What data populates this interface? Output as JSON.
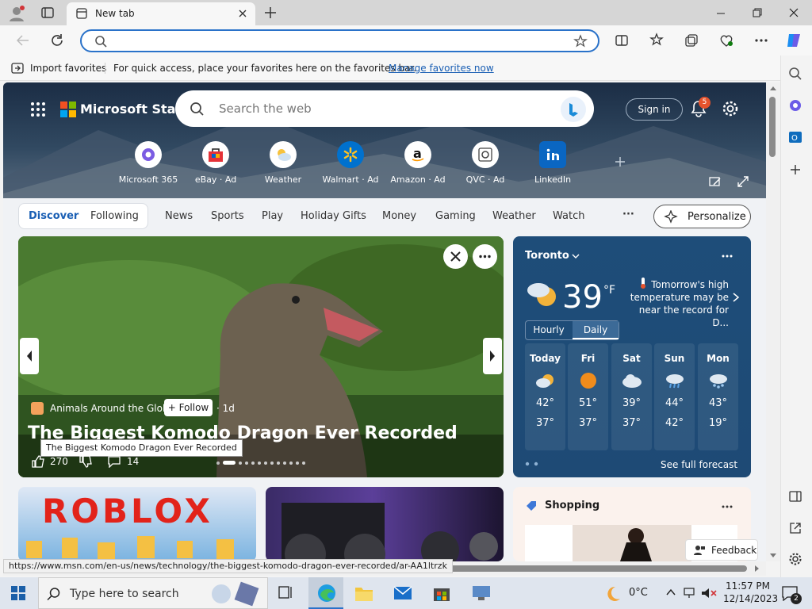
{
  "browser": {
    "tab_title": "New tab",
    "address_value": "",
    "favorites_bar": {
      "import_label": "Import favorites",
      "hint": "For quick access, place your favorites here on the favorites bar.",
      "manage_link": "Manage favorites now"
    },
    "status_url": "https://www.msn.com/en-us/news/technology/the-biggest-komodo-dragon-ever-recorded/ar-AA1ltrzk"
  },
  "msn": {
    "brand": "Microsoft Start",
    "search_placeholder": "Search the web",
    "sign_in": "Sign in",
    "notification_count": "5",
    "quick_links": [
      {
        "label": "Microsoft 365"
      },
      {
        "label": "eBay · Ad"
      },
      {
        "label": "Weather"
      },
      {
        "label": "Walmart · Ad"
      },
      {
        "label": "Amazon · Ad"
      },
      {
        "label": "QVC · Ad"
      },
      {
        "label": "LinkedIn"
      }
    ],
    "nav_tabs": [
      "Discover",
      "Following",
      "News",
      "Sports",
      "Play",
      "Holiday Gifts",
      "Money",
      "Gaming",
      "Weather",
      "Watch"
    ],
    "nav_more": "···",
    "personalize": "Personalize"
  },
  "hero": {
    "source": "Animals Around the Globe",
    "follow": "+ Follow",
    "age": "· 1d",
    "headline": "The Biggest Komodo Dragon Ever Recorded",
    "tooltip": "The Biggest Komodo Dragon Ever Recorded",
    "likes": "270",
    "comments": "14"
  },
  "weather": {
    "city": "Toronto",
    "temp": "39",
    "unit": "°F",
    "note": "Tomorrow's high temperature may be near the record for D...",
    "tab_hourly": "Hourly",
    "tab_daily": "Daily",
    "days": [
      {
        "day": "Today",
        "high": "42°",
        "low": "37°",
        "icon": "partly-cloudy-icon"
      },
      {
        "day": "Fri",
        "high": "51°",
        "low": "37°",
        "icon": "sun-icon"
      },
      {
        "day": "Sat",
        "high": "39°",
        "low": "37°",
        "icon": "cloud-icon"
      },
      {
        "day": "Sun",
        "high": "44°",
        "low": "42°",
        "icon": "rain-icon"
      },
      {
        "day": "Mon",
        "high": "43°",
        "low": "19°",
        "icon": "snow-icon"
      }
    ],
    "full_forecast": "See full forecast"
  },
  "cards": {
    "roblox_text": "ROBLOX",
    "shopping_title": "Shopping",
    "feedback": "Feedback"
  },
  "taskbar": {
    "search_placeholder": "Type here to search",
    "temp": "0°C",
    "time": "11:57 PM",
    "date": "12/14/2023",
    "notifications": "2"
  },
  "colors": {
    "accent": "#2a72c9",
    "weather_bg": "#1e4d79",
    "badge": "#e5532d"
  }
}
